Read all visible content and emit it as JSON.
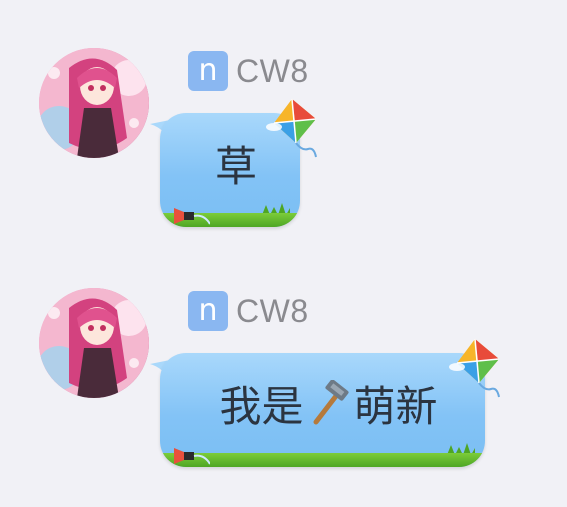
{
  "messages": [
    {
      "sender_badge": "n",
      "sender_name": "CW8",
      "text": "草"
    },
    {
      "sender_badge": "n",
      "sender_name": "CW8",
      "text_before": "我是",
      "emoji": "hammer-icon",
      "text_after": "萌新"
    }
  ],
  "colors": {
    "background": "#f1f1f6",
    "badge": "#8ab7f1",
    "bubble_top": "#a9d8fb",
    "bubble_bottom": "#7abef3",
    "grass": "#4ea624",
    "name": "#8a8a8f"
  }
}
